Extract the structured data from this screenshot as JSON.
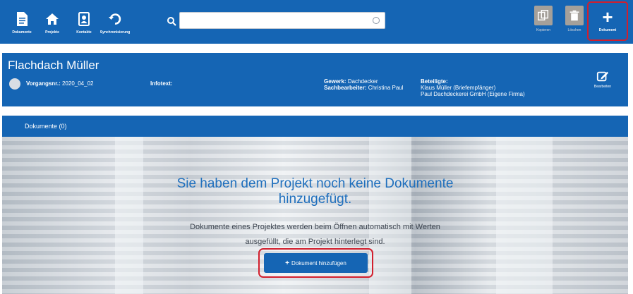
{
  "toolbar": {
    "items": [
      {
        "label": "Dokumente",
        "icon": "document-icon"
      },
      {
        "label": "Projekte",
        "icon": "home-icon"
      },
      {
        "label": "Kontakte",
        "icon": "contacts-icon"
      },
      {
        "label": "Synchronisierung",
        "icon": "sync-icon"
      }
    ],
    "search": {
      "value": "",
      "placeholder": ""
    },
    "right_items": [
      {
        "label": "Kopieren",
        "icon": "copy-icon"
      },
      {
        "label": "Löschen",
        "icon": "trash-icon"
      }
    ],
    "new_doc_label": "Dokument"
  },
  "project": {
    "title": "Flachdach Müller",
    "vorgangsnr_label": "Vorgangsnr.:",
    "vorgangsnr_value": "2020_04_02",
    "infotext_label": "Infotext:",
    "gewerk_label": "Gewerk:",
    "gewerk_value": "Dachdecker",
    "sachbearbeiter_label": "Sachbearbeiter:",
    "sachbearbeiter_value": "Christina Paul",
    "beteiligte_label": "Beteiligte:",
    "beteiligte_1": "Klaus Müller (Briefempfänger)",
    "beteiligte_2": "Paul Dachdeckerei GmbH (Eigene Firma)",
    "edit_label": "Bearbeiten"
  },
  "documents": {
    "tab_label": "Dokumente (0)",
    "empty_title_1": "Sie haben dem Projekt noch keine Dokumente",
    "empty_title_2": "hinzugefügt.",
    "empty_desc_1": "Dokumente eines Projektes werden beim Öffnen automatisch mit Werten",
    "empty_desc_2": "ausgefüllt, die am Projekt hinterlegt sind.",
    "add_button_label": "Dokument hinzufügen",
    "add_button_plus": "+"
  },
  "colors": {
    "primary": "#1565b4",
    "highlight": "#d21f2d",
    "title_text": "#1f6fbd"
  }
}
